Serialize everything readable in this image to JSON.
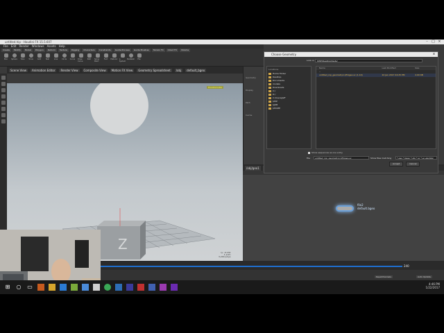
{
  "app": {
    "title": "untitled.hip - Houdini FX 15.5.607"
  },
  "menubar": [
    "File",
    "Edit",
    "Render",
    "Windows",
    "Assets",
    "Help"
  ],
  "shelf": {
    "tabs": [
      "Create",
      "Modify",
      "Model",
      "Polygon",
      "Deform",
      "Texture",
      "Rigging",
      "Characters",
      "Constraints",
      "Guide Process",
      "Guide Brushes",
      "Terrain FX",
      "Cloud FX",
      "Volume"
    ],
    "tools": [
      "Box",
      "Sphere",
      "Tube",
      "Torus",
      "Grid",
      "Null",
      "Line",
      "Circle",
      "Curve",
      "Draw Curve",
      "Path",
      "Spray Paint",
      "Font",
      "Platonic",
      "L-System",
      "Metaball",
      "File"
    ]
  },
  "viewport": {
    "tabs": [
      "Scene View",
      "Animation Editor",
      "Render View",
      "Composite View",
      "Motion FX View",
      "Geometry Spreadsheet"
    ],
    "path": "/obj",
    "node": "default_bgeo",
    "label": "Houdini Indie",
    "stats": [
      "ry: -0.132",
      "1 prim",
      "3,200 polys"
    ],
    "box_letter": "Z"
  },
  "parm_labels": [
    "Geometry",
    "Display",
    "Path",
    "Cache"
  ],
  "dialog": {
    "title": "Choose Geometry",
    "close": "x",
    "path_label": "Look in",
    "path_value": "$HIP/Desktop/tests/",
    "locations_label": "Locations",
    "locations": [
      "Home Folder",
      "Desktop",
      "Documents",
      "models",
      "Downloads",
      "C:/",
      "D:/",
      "C:/Users/Jeff",
      "$HIP",
      "$JOB",
      "$HOME"
    ],
    "columns": [
      "Name",
      "Last Modified",
      "Size"
    ],
    "files": [
      {
        "name": "..",
        "date": "",
        "size": ""
      },
      {
        "name": "untitled_rop_geometry1.$F.bgeo.sc (1-10)",
        "date": "22 Jan 2017 04:25 PM",
        "size": "2.00 KB"
      }
    ],
    "checkbox": "Show sequences as one entry",
    "file_label": "File",
    "file_value": "untitled_rop_geometry1.$F.bgeo.sc",
    "show_label": "Show files matching",
    "filter_value": "*.geo *.bgeo *.obj *.sc *.sc-alembic",
    "accept": "Accept",
    "cancel": "Cancel"
  },
  "network": {
    "tabs": [
      "/obj/geo1",
      "Tree View",
      "Material Palette",
      "Asset Browser"
    ],
    "node_name": "file2",
    "node_file": "default.bgeo"
  },
  "timeline": {
    "current_frame": "1",
    "start": "1",
    "end": "240"
  },
  "statusbar": {
    "update": "Auto Update",
    "keyframes": "Keys/Channels"
  },
  "taskbar": {
    "time": "4:46 PM",
    "date": "1/22/2017"
  },
  "colors": {
    "timeline_bar": "#1f6fd0",
    "node_highlight": "#8ec3ff",
    "folder": "#d2a84a"
  }
}
